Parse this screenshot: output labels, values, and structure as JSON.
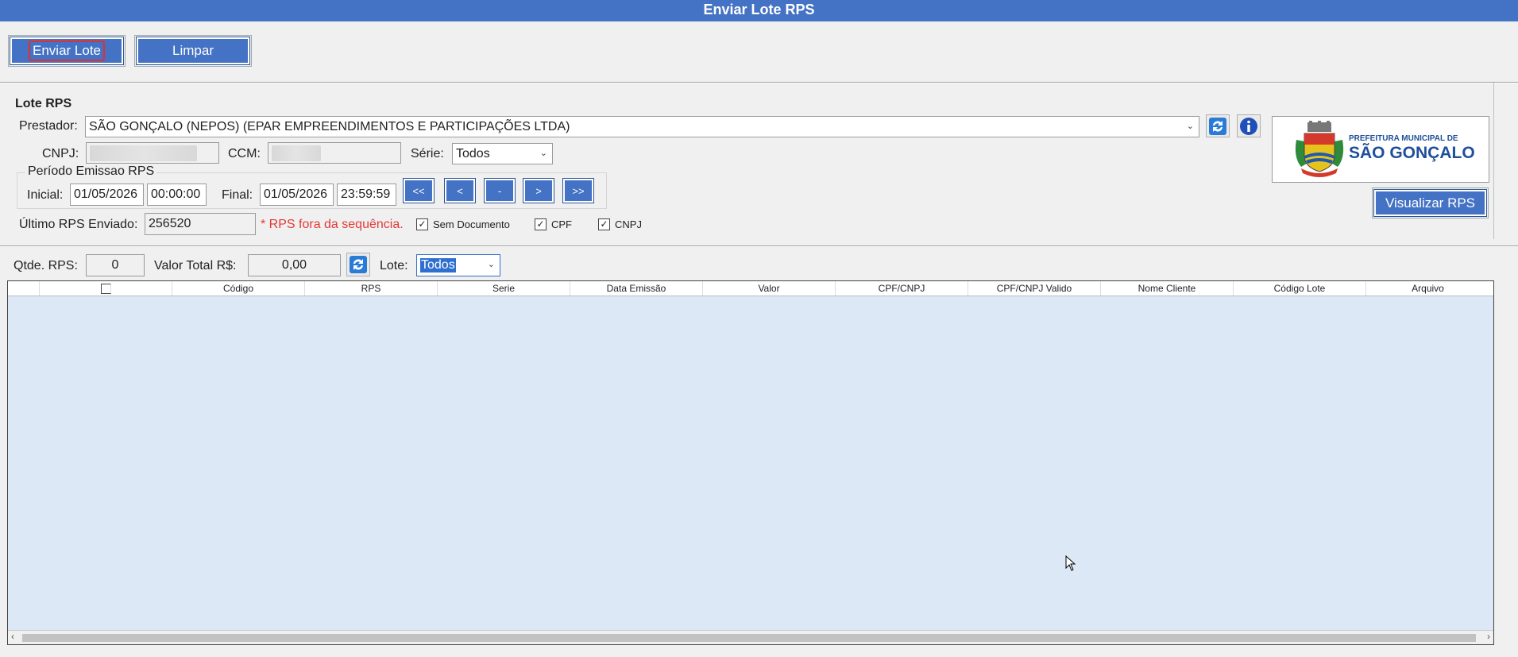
{
  "window": {
    "title": "Enviar Lote RPS"
  },
  "toolbar": {
    "send_label": "Enviar Lote",
    "clear_label": "Limpar"
  },
  "lote": {
    "section_title": "Lote RPS",
    "prestador_label": "Prestador:",
    "prestador_value": "SÃO GONÇALO (NEPOS) (EPAR EMPREENDIMENTOS E PARTICIPAÇÕES LTDA)",
    "cnpj_label": "CNPJ:",
    "ccm_label": "CCM:",
    "serie_label": "Série:",
    "serie_value": "Todos",
    "periodo_title": "Período Emissao RPS",
    "inicial_label": "Inicial:",
    "inicial_date": "01/05/2026",
    "inicial_time": "00:00:00",
    "final_label": "Final:",
    "final_date": "01/05/2026",
    "final_time": "23:59:59",
    "nav": {
      "first": "<<",
      "prev": "<",
      "current": "-",
      "next": ">",
      "last": ">>"
    },
    "ultimo_label": "Último RPS Enviado:",
    "ultimo_value": "256520",
    "warning": "* RPS fora da sequência.",
    "checks": [
      {
        "label": "Sem Documento",
        "checked": true
      },
      {
        "label": "CPF",
        "checked": true
      },
      {
        "label": "CNPJ",
        "checked": true
      }
    ]
  },
  "logo": {
    "line1": "PREFEITURA MUNICIPAL DE",
    "line2": "SÃO GONÇALO"
  },
  "visualizar_label": "Visualizar RPS",
  "summary": {
    "qtde_label": "Qtde. RPS:",
    "qtde_value": "0",
    "valor_label": "Valor Total R$:",
    "valor_value": "0,00",
    "lote_label": "Lote:",
    "lote_value": "Todos"
  },
  "table": {
    "columns": [
      "",
      "",
      "Código",
      "RPS",
      "Serie",
      "Data Emissão",
      "Valor",
      "CPF/CNPJ",
      "CPF/CNPJ Valido",
      "Nome Cliente",
      "Código Lote",
      "Arquivo"
    ],
    "rows": []
  },
  "colors": {
    "accent": "#4472c4",
    "grid_bg": "#dce8f6",
    "warning": "#e53935"
  }
}
